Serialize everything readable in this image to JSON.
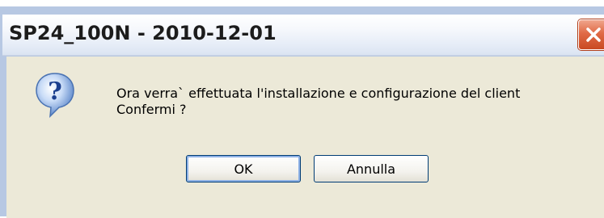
{
  "dialog": {
    "title": "SP24_100N - 2010-12-01",
    "message_line1": "Ora verra` effettuata l'installazione e configurazione del client",
    "message_line2": "Confermi ?",
    "ok_label": "OK",
    "cancel_label": "Annulla",
    "icon": "question-icon",
    "close_icon": "close-icon"
  },
  "colors": {
    "client_background": "#ece9d8",
    "frame": "#b7c8e3",
    "close_button": "#e06a46",
    "button_border": "#003c74"
  }
}
